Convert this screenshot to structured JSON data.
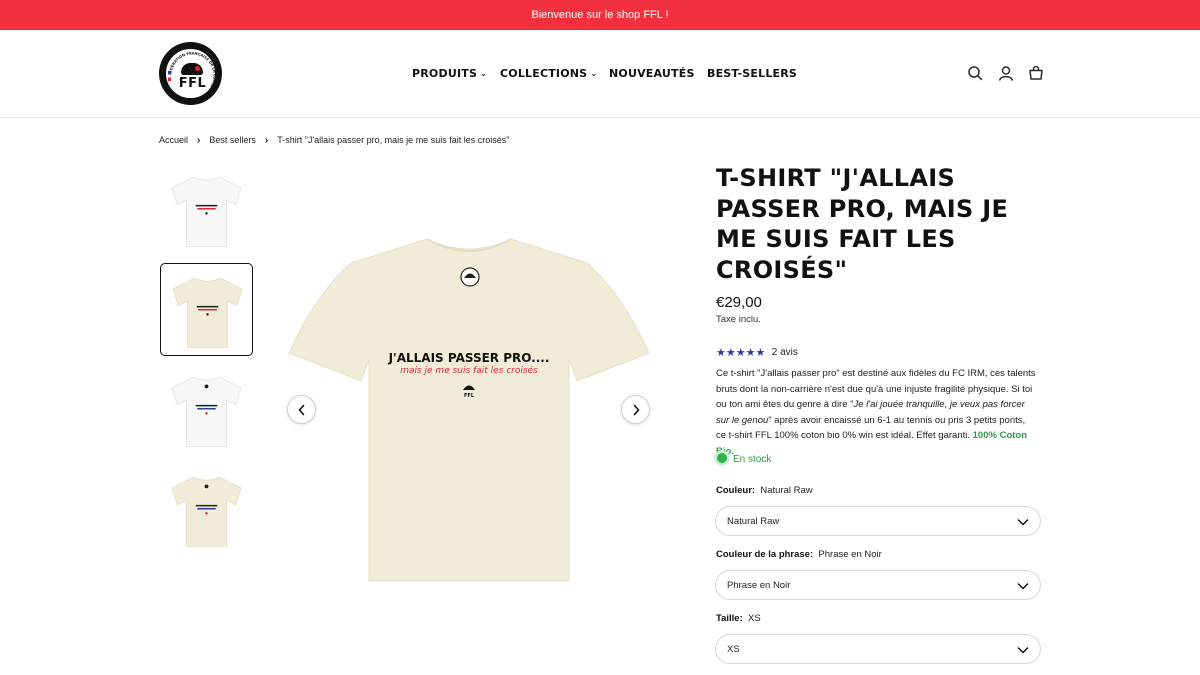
{
  "announcement": "Bienvenue sur le shop FFL !",
  "logo": {
    "text": "FFL",
    "ring_text": "FÉDÉRATION FRANÇAISE DE LA LOOSE",
    "alt": "FFL logo"
  },
  "nav": {
    "items": [
      {
        "label": "PRODUITS",
        "has_dropdown": true
      },
      {
        "label": "COLLECTIONS",
        "has_dropdown": true
      },
      {
        "label": "NOUVEAUTÉS",
        "has_dropdown": false
      },
      {
        "label": "BEST-SELLERS",
        "has_dropdown": false
      }
    ]
  },
  "header_icons": [
    "search-icon",
    "account-icon",
    "cart-icon"
  ],
  "breadcrumb": [
    "Accueil",
    "Best sellers",
    "T-shirt \"J'allais passer pro, mais je me suis fait les croisés\""
  ],
  "gallery": {
    "thumbnails": [
      {
        "color": "white",
        "selected": false
      },
      {
        "color": "natural-raw",
        "selected": true
      },
      {
        "color": "white",
        "selected": false
      },
      {
        "color": "natural-raw",
        "selected": false
      }
    ],
    "main_print": {
      "line1": "J'ALLAIS PASSER PRO....",
      "line2": "mais je me suis fait les croisés",
      "brand": "FFL"
    }
  },
  "product": {
    "title": "T-SHIRT \"J'ALLAIS PASSER PRO, MAIS JE ME SUIS FAIT LES CROISÉS\"",
    "price": "€29,00",
    "tax_note": "Taxe inclu.",
    "rating_stars": 5,
    "stars_text": "★★★★★",
    "reviews": "2 avis",
    "desc_1": "Ce t-shirt \"J'allais passer pro\" est destiné aux fidèles du FC IRM, ces talents bruts dont la non-carrière n'est due qu'à une injuste fragilité physique. Si toi ou ton ami êtes du genre à dire \"",
    "desc_italic": "Je l'ai jouée tranquille, je veux pas forcer sur le genou",
    "desc_2": "\" après avoir encaissé un 6-1 au tennis ou pris 3 petits ponts, ce t-shirt FFL 100% coton bio 0% win est idéal. Effet garanti. ",
    "desc_green": "100% Coton Bio.",
    "stock": "En stock",
    "options": [
      {
        "label": "Couleur:",
        "value": "Natural Raw",
        "selected": "Natural Raw"
      },
      {
        "label": "Couleur de la phrase:",
        "value": "Phrase en Noir",
        "selected": "Phrase en Noir"
      },
      {
        "label": "Taille:",
        "value": "XS",
        "selected": "XS"
      }
    ]
  },
  "colors": {
    "announcement_bg": "#f2303d",
    "star": "#2e3c99",
    "in_stock": "#2a9d4a",
    "tee_white": "#f7f7f7",
    "tee_natural": "#f1ecd7",
    "print_red": "#d8253a"
  }
}
